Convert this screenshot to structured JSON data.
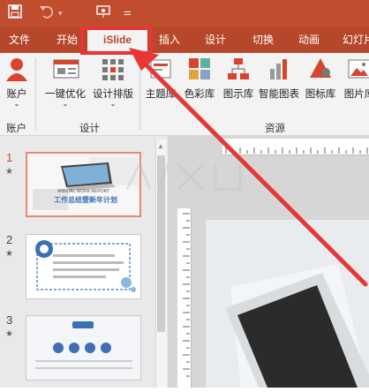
{
  "quick_access": {
    "save_icon": "save-icon",
    "undo_icon": "undo-icon",
    "slideshow_icon": "slideshow-icon",
    "customize_icon": "customize-icon"
  },
  "tabs": [
    {
      "label": "文件"
    },
    {
      "label": "开始"
    },
    {
      "label": "iSlide"
    },
    {
      "label": "插入"
    },
    {
      "label": "设计"
    },
    {
      "label": "切换"
    },
    {
      "label": "动画"
    },
    {
      "label": "幻灯片"
    }
  ],
  "ribbon": {
    "account": {
      "button_label": "账户",
      "group_label": "账户"
    },
    "design": {
      "one_click_label": "一键优化",
      "layout_label": "设计排版",
      "group_label": "设计"
    },
    "resources": {
      "group_label": "资源",
      "items": [
        {
          "label": "主题库",
          "icon": "theme-library-icon"
        },
        {
          "label": "色彩库",
          "icon": "color-library-icon"
        },
        {
          "label": "图示库",
          "icon": "diagram-library-icon"
        },
        {
          "label": "智能图表",
          "icon": "smart-chart-icon"
        },
        {
          "label": "图标库",
          "icon": "icon-library-icon"
        },
        {
          "label": "图片库",
          "icon": "picture-library-icon"
        }
      ]
    }
  },
  "slides": [
    {
      "number": "1",
      "star": "★",
      "title_text": "工作总结暨新年计划",
      "subtitle_text": "ANNUAL WORK REPORT"
    },
    {
      "number": "2",
      "star": "★"
    },
    {
      "number": "3",
      "star": "★"
    }
  ],
  "colors": {
    "accent": "#b7472a",
    "highlight": "#e83535"
  }
}
